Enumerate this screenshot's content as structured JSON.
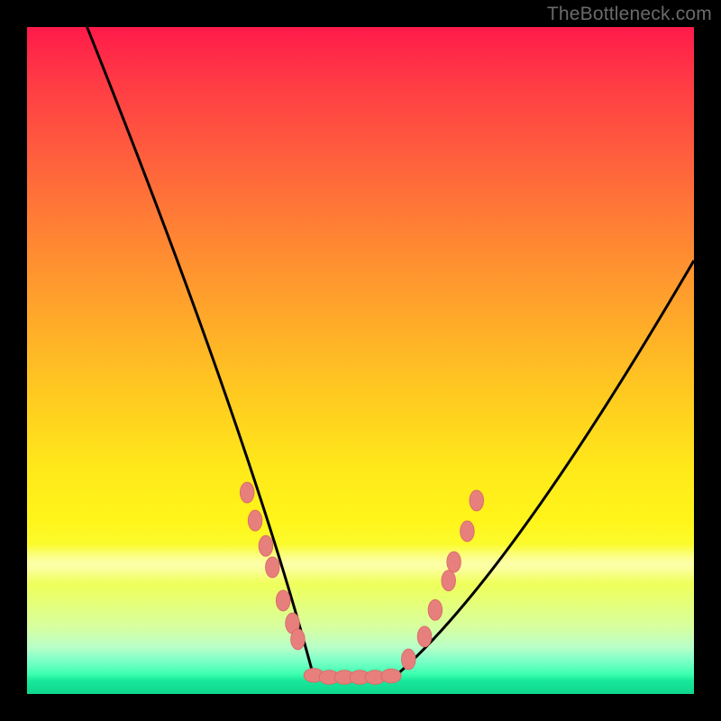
{
  "watermark": "TheBottleneck.com",
  "colors": {
    "curve_stroke": "#000000",
    "marker_fill": "#e77f7d",
    "marker_stroke": "#d96a68",
    "frame": "#000000"
  },
  "chart_data": {
    "type": "line",
    "title": "",
    "xlabel": "",
    "ylabel": "",
    "xlim": [
      0,
      100
    ],
    "ylim": [
      0,
      100
    ],
    "left_curve": {
      "start": [
        9,
        100
      ],
      "end": [
        43,
        2.5
      ],
      "control": [
        33,
        40
      ]
    },
    "flat_segment": {
      "start": [
        43,
        2.5
      ],
      "end": [
        55,
        2.5
      ]
    },
    "right_curve": {
      "start": [
        55,
        2.5
      ],
      "end": [
        100,
        65
      ],
      "control": [
        72,
        17
      ]
    },
    "left_markers_xy": [
      [
        33.0,
        30.2
      ],
      [
        34.2,
        26.0
      ],
      [
        35.8,
        22.2
      ],
      [
        36.8,
        19.0
      ],
      [
        38.4,
        14.0
      ],
      [
        39.8,
        10.6
      ],
      [
        40.6,
        8.2
      ]
    ],
    "flat_markers_xy": [
      [
        43.0,
        2.8
      ],
      [
        45.3,
        2.5
      ],
      [
        47.6,
        2.5
      ],
      [
        49.9,
        2.5
      ],
      [
        52.2,
        2.5
      ],
      [
        54.6,
        2.7
      ]
    ],
    "right_markers_xy": [
      [
        57.2,
        5.2
      ],
      [
        59.6,
        8.6
      ],
      [
        61.2,
        12.6
      ],
      [
        63.2,
        17.0
      ],
      [
        64.0,
        19.8
      ],
      [
        66.0,
        24.4
      ],
      [
        67.4,
        29.0
      ]
    ]
  }
}
